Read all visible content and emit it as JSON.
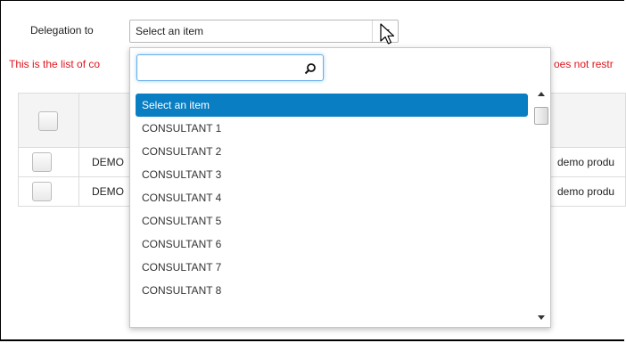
{
  "form": {
    "delegation_label": "Delegation to",
    "selected_value": "Select an item"
  },
  "message": {
    "left": "This is the list of co",
    "right": "oes not restr"
  },
  "table": {
    "rows": [
      {
        "name": "DEMO",
        "product": "demo produ"
      },
      {
        "name": "DEMO",
        "product": "demo produ"
      }
    ]
  },
  "dropdown": {
    "search_value": "",
    "options": [
      "Select an item",
      "CONSULTANT 1",
      "CONSULTANT 2",
      "CONSULTANT 3",
      "CONSULTANT 4",
      "CONSULTANT 5",
      "CONSULTANT 6",
      "CONSULTANT 7",
      "CONSULTANT 8"
    ],
    "selected_index": 0
  },
  "colors": {
    "accent_selected": "#0a7ec2",
    "error_text": "#e0141c",
    "focus_border": "#66afe9"
  },
  "icons": {
    "search": "search-icon",
    "cursor": "mouse-cursor-icon",
    "dropdown_arrow": "chevron-down-icon"
  }
}
